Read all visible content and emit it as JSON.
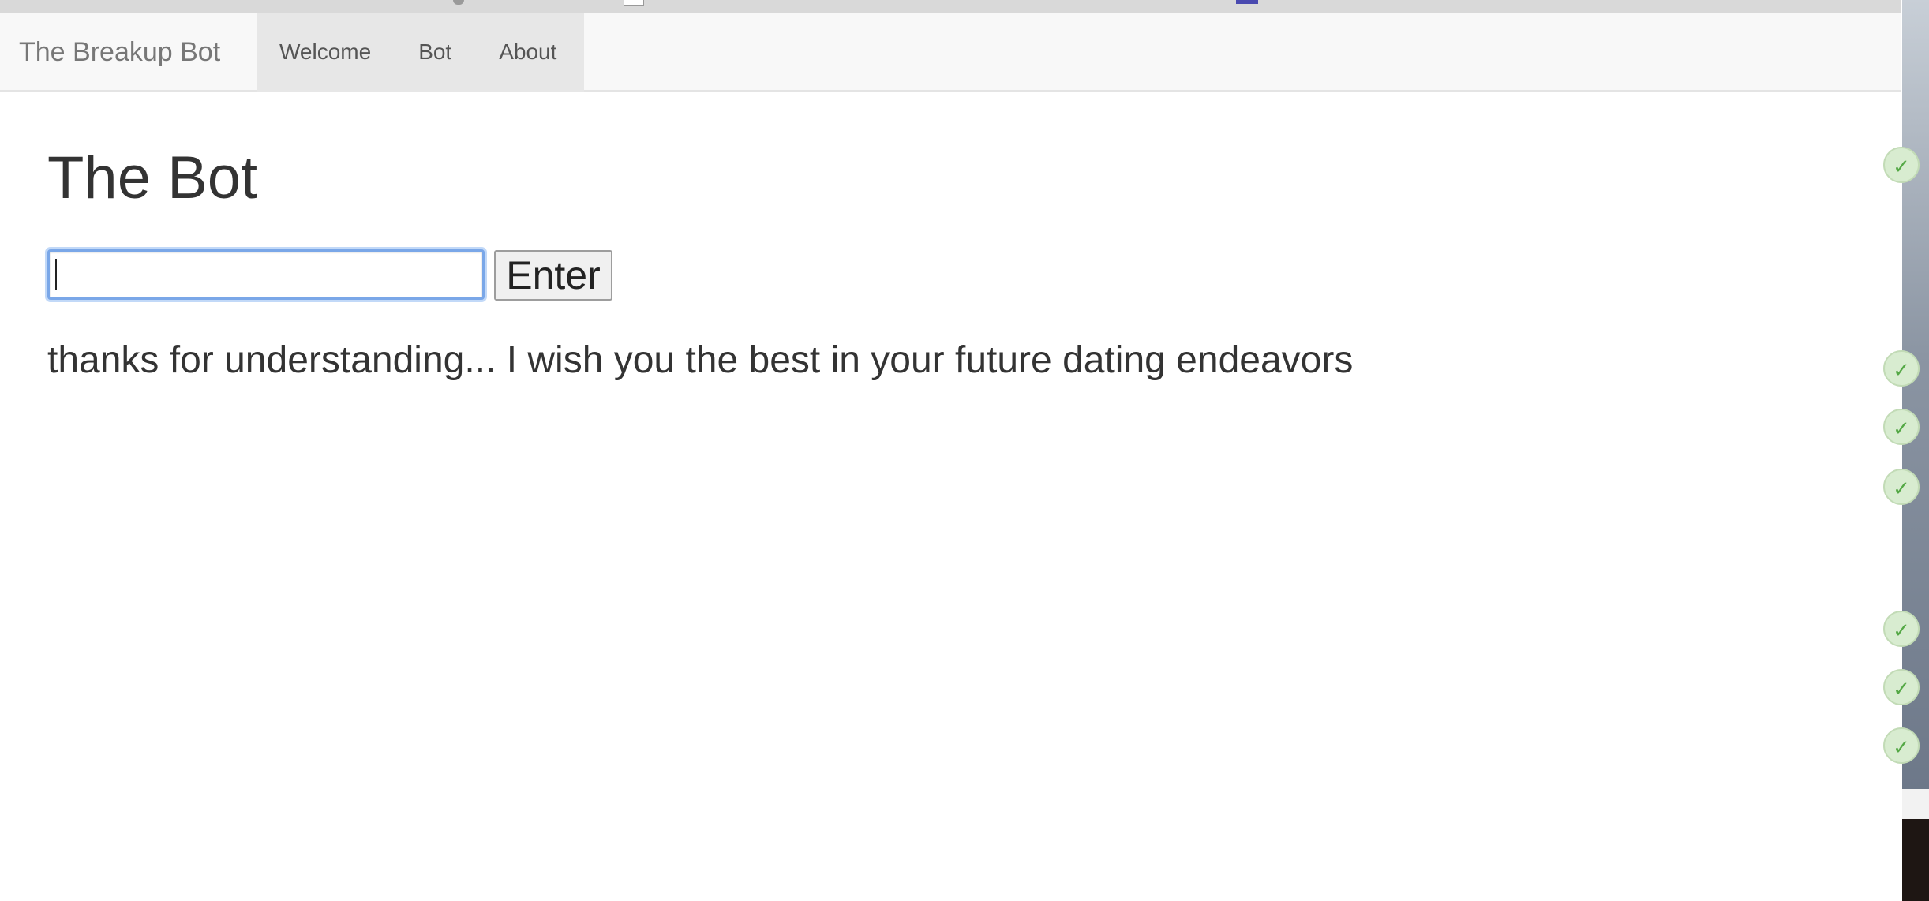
{
  "navbar": {
    "brand": "The Breakup Bot",
    "items": [
      {
        "label": "Welcome"
      },
      {
        "label": "Bot"
      },
      {
        "label": "About"
      }
    ]
  },
  "main": {
    "title": "The Bot",
    "input": {
      "value": "",
      "placeholder": ""
    },
    "enter_label": "Enter",
    "response": "thanks for understanding... I wish you the best in your future dating endeavors"
  },
  "icons": {
    "badge": "check-circle-icon",
    "badge_glyph": "✓"
  },
  "colors": {
    "navbar_bg": "#f8f8f8",
    "nav_group_bg": "#e7e7e7",
    "focus_ring": "#7aa7e8",
    "check_green": "#54a845"
  }
}
